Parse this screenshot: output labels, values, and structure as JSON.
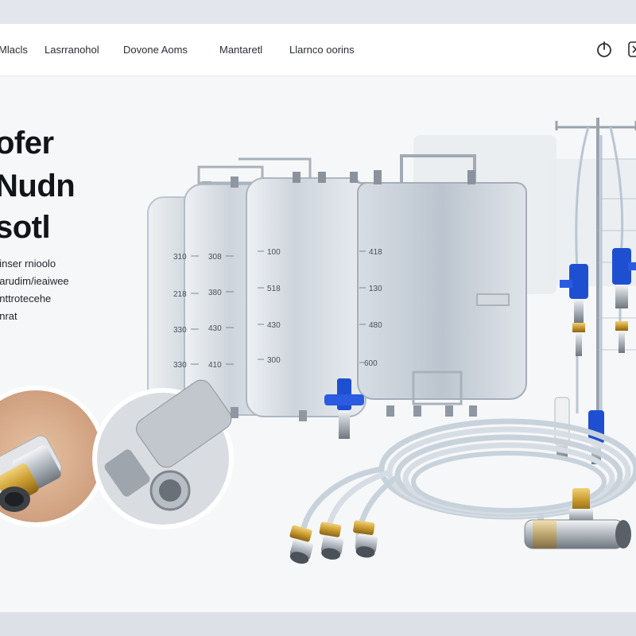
{
  "nav": {
    "links": [
      "Mlacls",
      "Lasrranohol",
      "Dovone Aoms",
      "Mantaretl",
      "Llarnco oorins"
    ],
    "icons": [
      "power-icon",
      "close-icon"
    ]
  },
  "hero": {
    "title_lines": [
      "ofer",
      "Nudn",
      "sotl"
    ],
    "desc_lines": [
      "hinser rnioolo",
      "narudim/ieaiwee",
      "unttrotecehe",
      "unrat"
    ]
  },
  "bags": [
    {
      "marks": [
        "310",
        "218",
        "330",
        "330"
      ]
    },
    {
      "marks": [
        "308",
        "380",
        "430",
        "410"
      ]
    },
    {
      "marks": [
        "100",
        "518",
        "430",
        "300"
      ]
    },
    {
      "marks": [
        "418",
        "130",
        "480",
        "600"
      ]
    }
  ],
  "colors": {
    "accent_blue": "#1f4fd1",
    "tube": "#cfd6dc",
    "brass": "#c99a2e",
    "bag_fill": "#c9d0d8"
  }
}
